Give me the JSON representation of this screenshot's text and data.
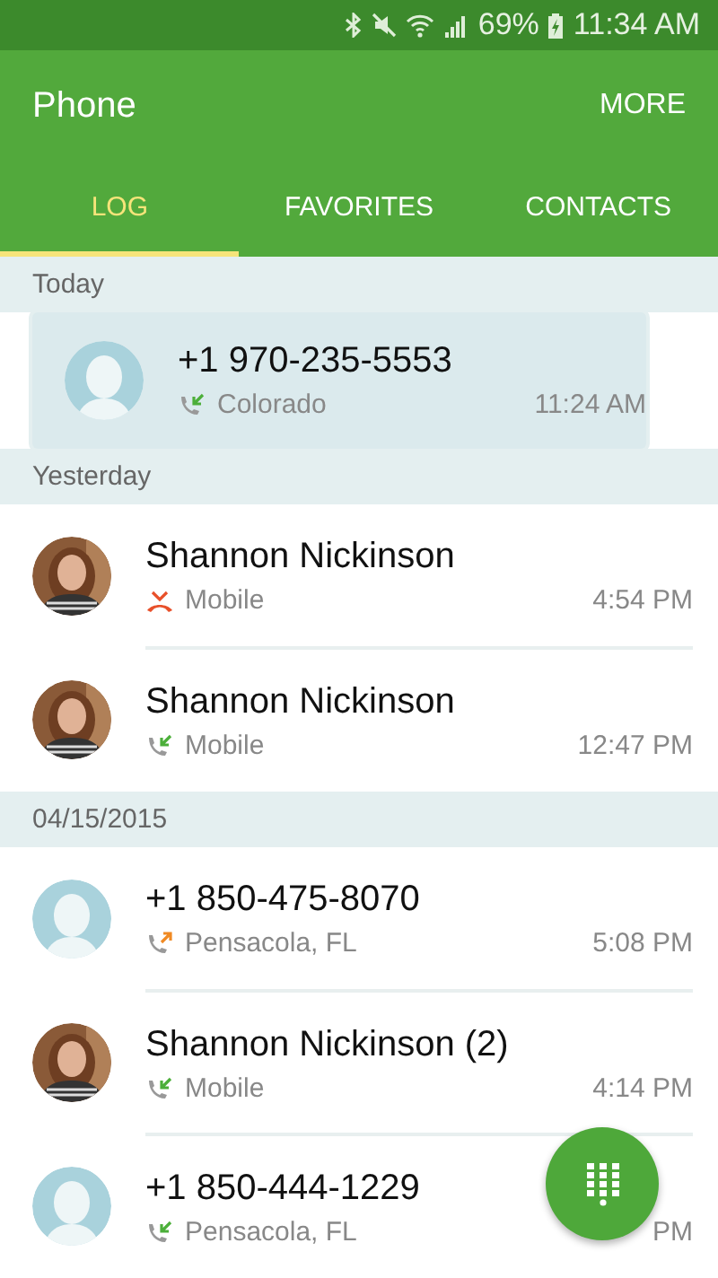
{
  "status_bar": {
    "battery": "69%",
    "time": "11:34 AM"
  },
  "app_bar": {
    "title": "Phone",
    "action": "MORE"
  },
  "tabs": [
    {
      "label": "LOG",
      "selected": true
    },
    {
      "label": "FAVORITES",
      "selected": false
    },
    {
      "label": "CONTACTS",
      "selected": false
    }
  ],
  "sections": [
    {
      "header": "Today",
      "calls": [
        {
          "name": "+1 970-235-5553",
          "kind": "incoming",
          "detail": "Colorado",
          "time": "11:24 AM",
          "avatar": {
            "kind": "placeholder"
          },
          "selected": true
        }
      ]
    },
    {
      "header": "Yesterday",
      "calls": [
        {
          "name": "Shannon Nickinson",
          "kind": "missed",
          "detail": "Mobile",
          "time": "4:54 PM",
          "selected": false
        },
        {
          "name": "Shannon Nickinson",
          "kind": "incoming",
          "detail": "Mobile",
          "time": "12:47 PM",
          "selected": false
        }
      ]
    },
    {
      "header": "04/15/2015",
      "calls": [
        {
          "name": "+1 850-475-8070",
          "kind": "outgoing",
          "detail": "Pensacola, FL",
          "time": "5:08 PM",
          "avatar": {
            "kind": "placeholder"
          },
          "selected": false
        },
        {
          "name": "Shannon Nickinson (2)",
          "kind": "incoming",
          "detail": "Mobile",
          "time": "4:14 PM",
          "selected": false
        },
        {
          "name": "+1 850-444-1229",
          "kind": "incoming",
          "detail": "Pensacola, FL",
          "time": "PM",
          "avatar": {
            "kind": "placeholder"
          },
          "selected": false
        }
      ]
    }
  ]
}
